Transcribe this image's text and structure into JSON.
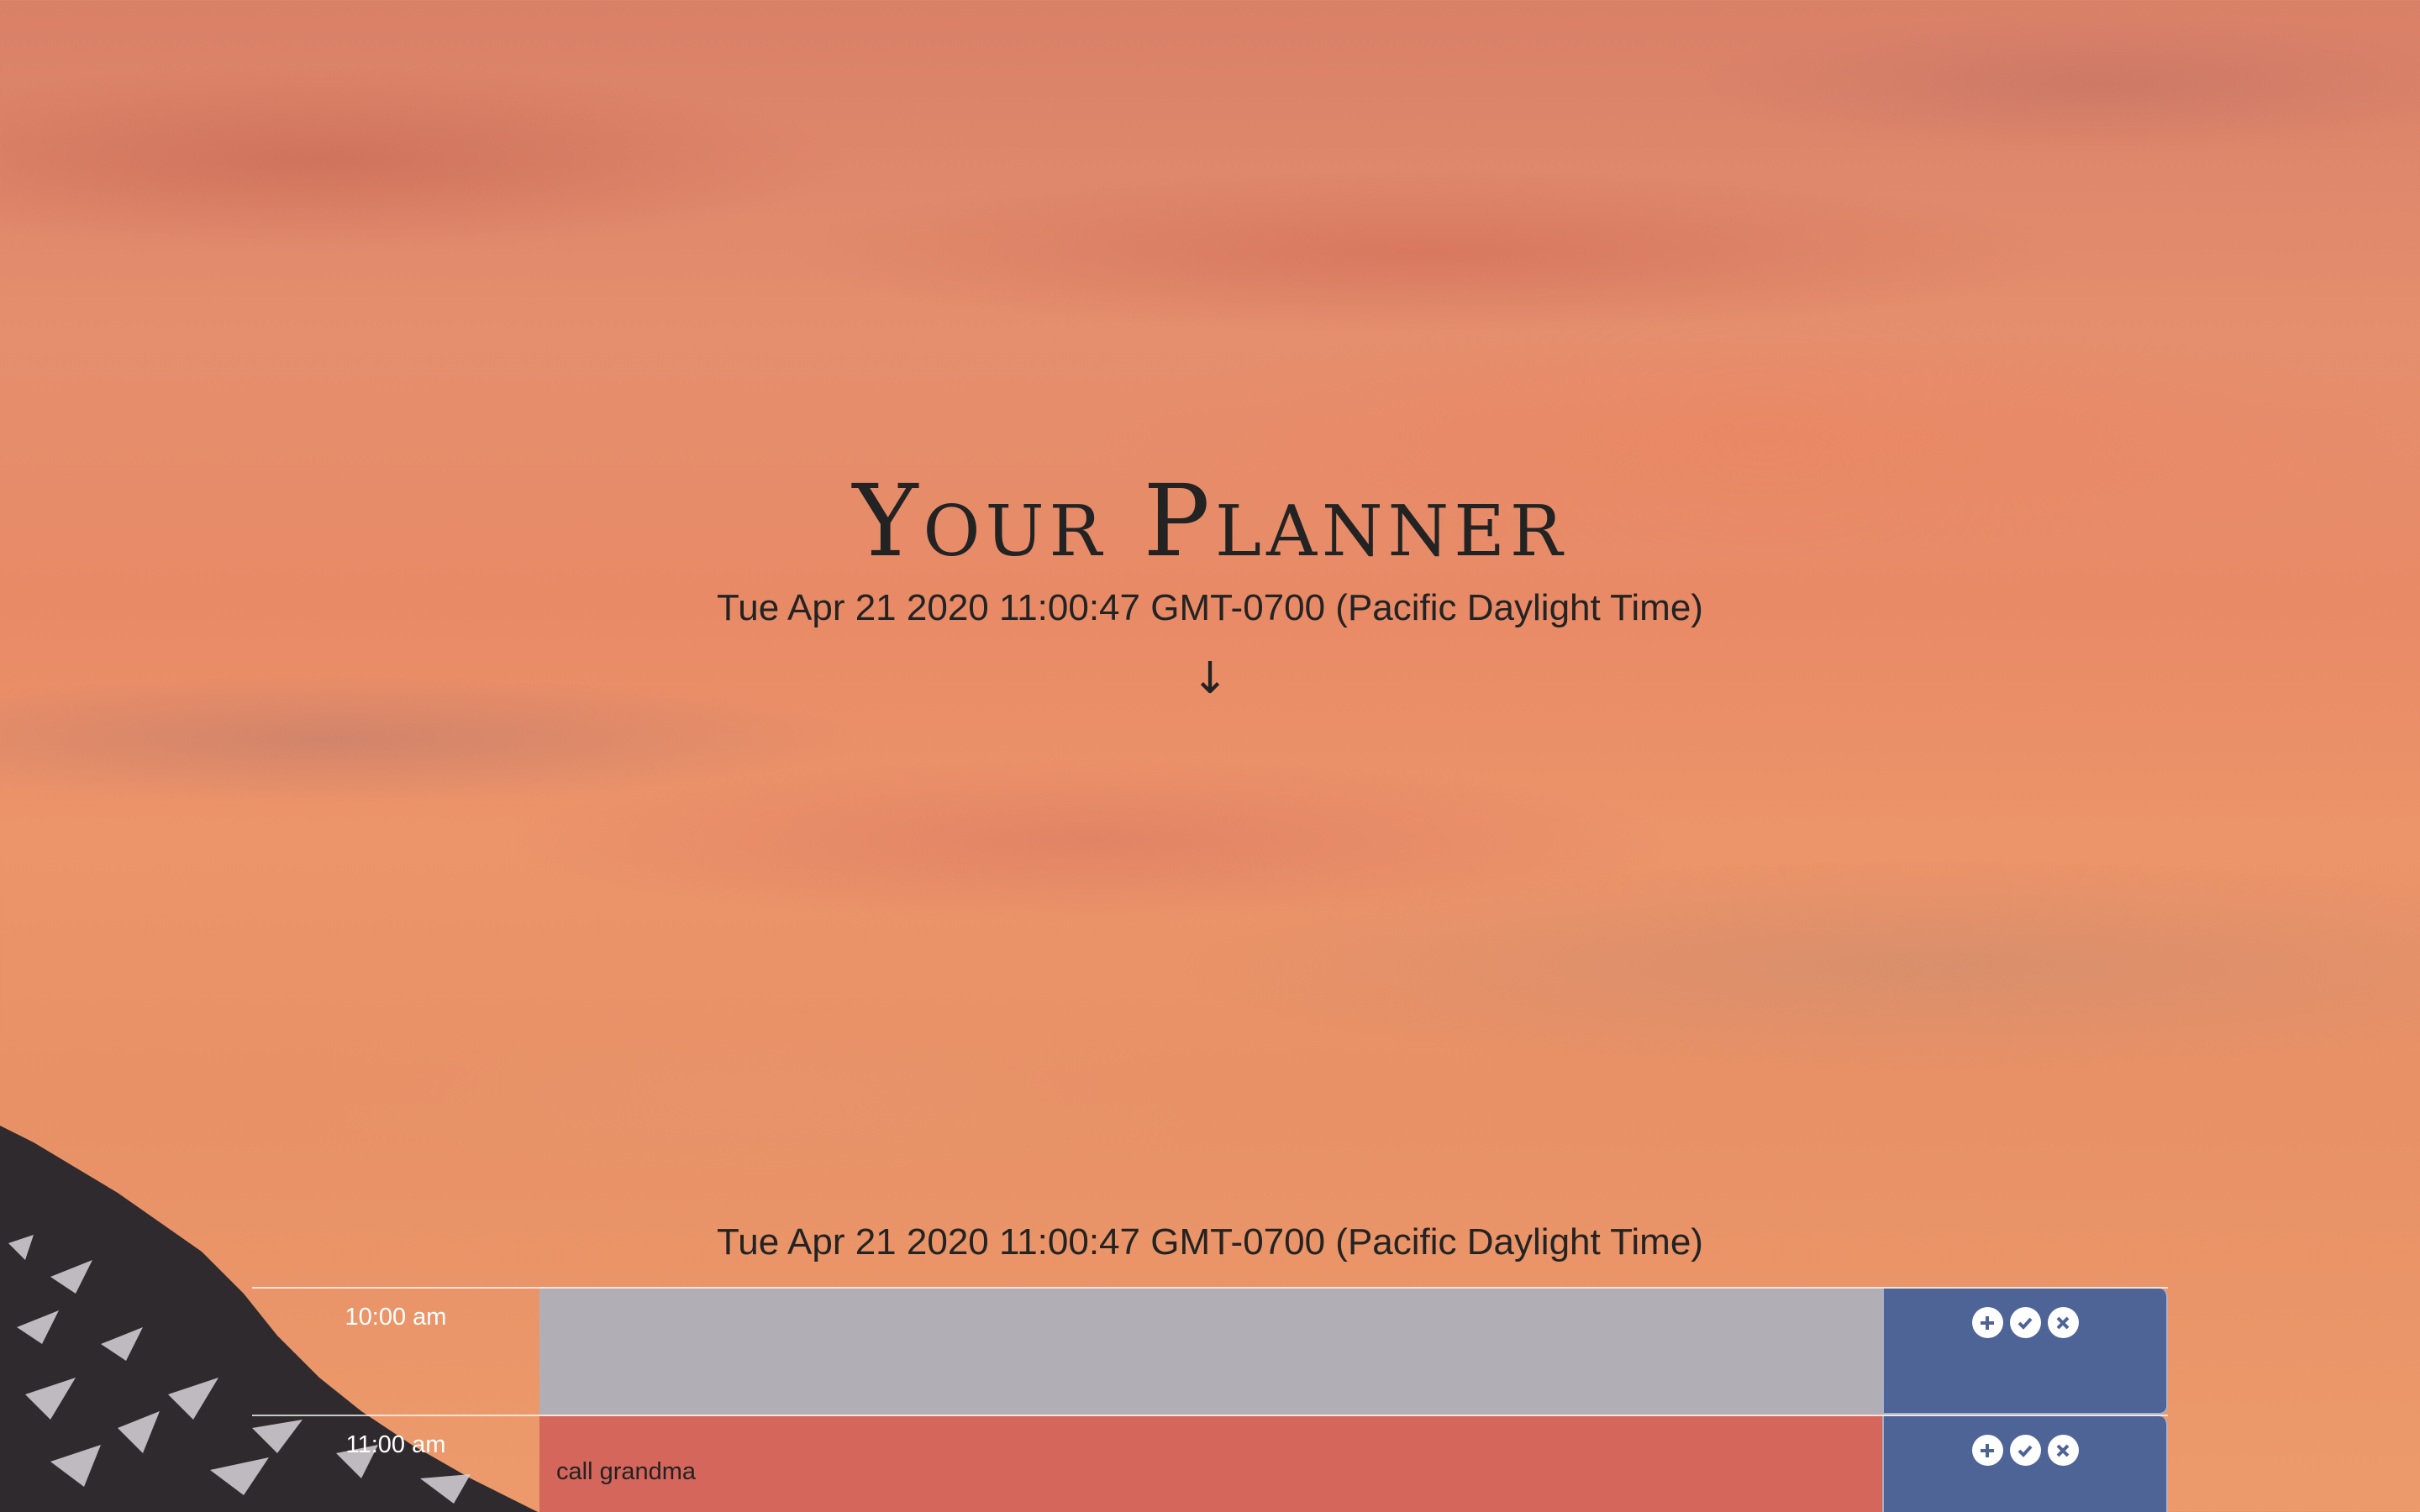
{
  "header": {
    "title": "Your Planner",
    "current_datetime": "Tue Apr 21 2020 11:00:47 GMT-0700 (Pacific Daylight Time)",
    "scroll_arrow": "↓"
  },
  "planner": {
    "current_datetime": "Tue Apr 21 2020 11:00:47 GMT-0700 (Pacific Daylight Time)",
    "rows": [
      {
        "hour": "10:00 am",
        "task": "",
        "status": "past",
        "actions": [
          "plus-circle-icon",
          "check-circle-icon",
          "times-circle-icon"
        ]
      },
      {
        "hour": "11:00 am",
        "task": "call grandma",
        "status": "present",
        "actions": [
          "plus-circle-icon",
          "check-circle-icon",
          "times-circle-icon"
        ]
      }
    ]
  },
  "colors": {
    "past": "#b2aeb5",
    "present": "#d4665c",
    "actions_bg": "#4e6396",
    "text": "#232323"
  }
}
